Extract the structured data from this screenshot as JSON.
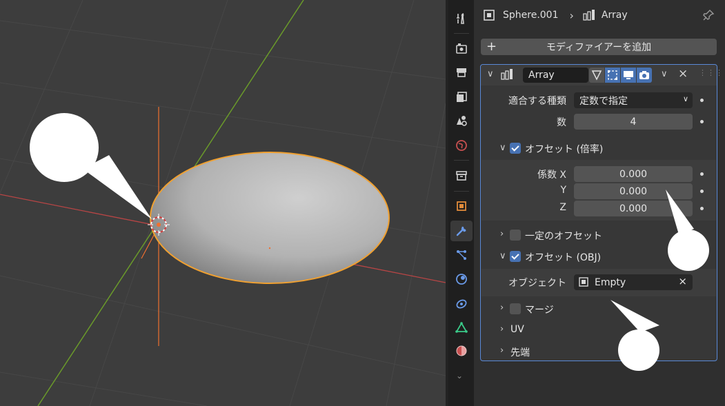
{
  "header": {
    "object_name": "Sphere.001",
    "modifier_name": "Array"
  },
  "add_modifier_label": "モディファイアーを追加",
  "modifier": {
    "name": "Array",
    "fit_type_label": "適合する種類",
    "fit_type_value": "定数で指定",
    "count_label": "数",
    "count_value": "4",
    "relative_offset": {
      "title": "オフセット (倍率)",
      "enabled": true,
      "factor_x_label": "係数 X",
      "factor_y_label": "Y",
      "factor_z_label": "Z",
      "x": "0.000",
      "y": "0.000",
      "z": "0.000"
    },
    "constant_offset": {
      "title": "一定のオフセット",
      "enabled": false
    },
    "object_offset": {
      "title": "オフセット (OBJ)",
      "enabled": true,
      "object_label": "オブジェクト",
      "object_value": "Empty"
    },
    "merge": {
      "title": "マージ",
      "enabled": false
    },
    "uv_title": "UV",
    "caps_title": "先端"
  },
  "colors": {
    "accent_blue": "#4772b3",
    "selection_orange": "#f0a030",
    "axis_red": "#c84a4a",
    "axis_green": "#6a9a2a"
  },
  "tabs": [
    "tool-icon",
    "render-icon",
    "output-icon",
    "view-layer-icon",
    "scene-icon",
    "world-icon",
    "collection-icon",
    "object-icon",
    "modifier-icon",
    "particles-icon",
    "physics-icon",
    "constraints-icon",
    "data-icon",
    "material-icon"
  ]
}
